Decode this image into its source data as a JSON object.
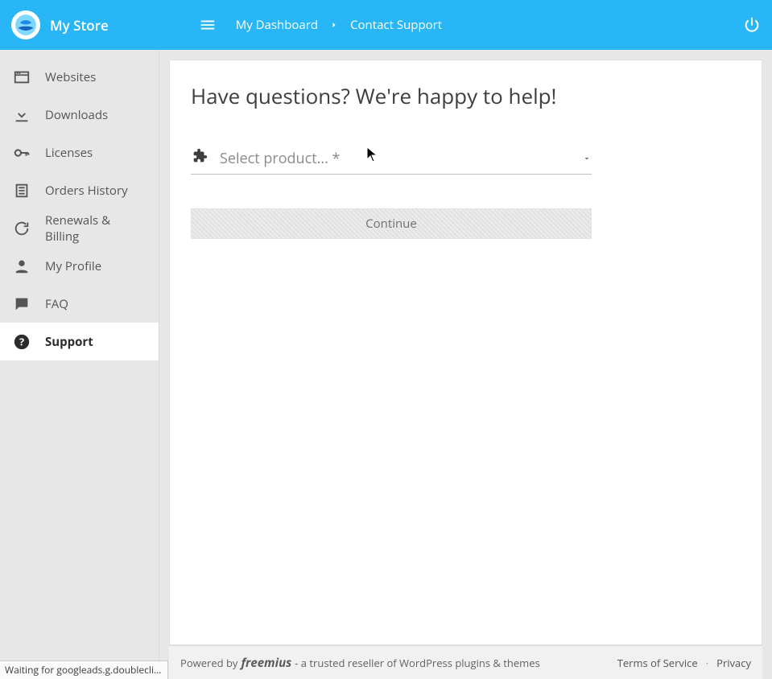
{
  "header": {
    "store_name": "My Store",
    "breadcrumbs": {
      "root": "My Dashboard",
      "current": "Contact Support"
    }
  },
  "sidebar": {
    "items": [
      {
        "id": "websites",
        "label": "Websites",
        "icon": "web-icon"
      },
      {
        "id": "downloads",
        "label": "Downloads",
        "icon": "download-icon"
      },
      {
        "id": "licenses",
        "label": "Licenses",
        "icon": "key-icon"
      },
      {
        "id": "orders",
        "label": "Orders History",
        "icon": "list-icon"
      },
      {
        "id": "renewals",
        "label": "Renewals & Billing",
        "icon": "refresh-icon"
      },
      {
        "id": "profile",
        "label": "My Profile",
        "icon": "person-icon"
      },
      {
        "id": "faq",
        "label": "FAQ",
        "icon": "chat-icon"
      },
      {
        "id": "support",
        "label": "Support",
        "icon": "help-icon"
      }
    ],
    "active": "support"
  },
  "main": {
    "title": "Have questions? We're happy to help!",
    "product_select": {
      "placeholder": "Select product... *",
      "value": ""
    },
    "continue_label": "Continue"
  },
  "footer": {
    "powered_by_prefix": "Powered by",
    "brand": "freemius",
    "tagline_suffix": "- a trusted reseller of WordPress plugins & themes",
    "links": {
      "terms": "Terms of Service",
      "privacy": "Privacy"
    }
  },
  "status": {
    "text": "Waiting for googleads.g.doublecli…"
  },
  "colors": {
    "primary": "#29b6f6"
  }
}
